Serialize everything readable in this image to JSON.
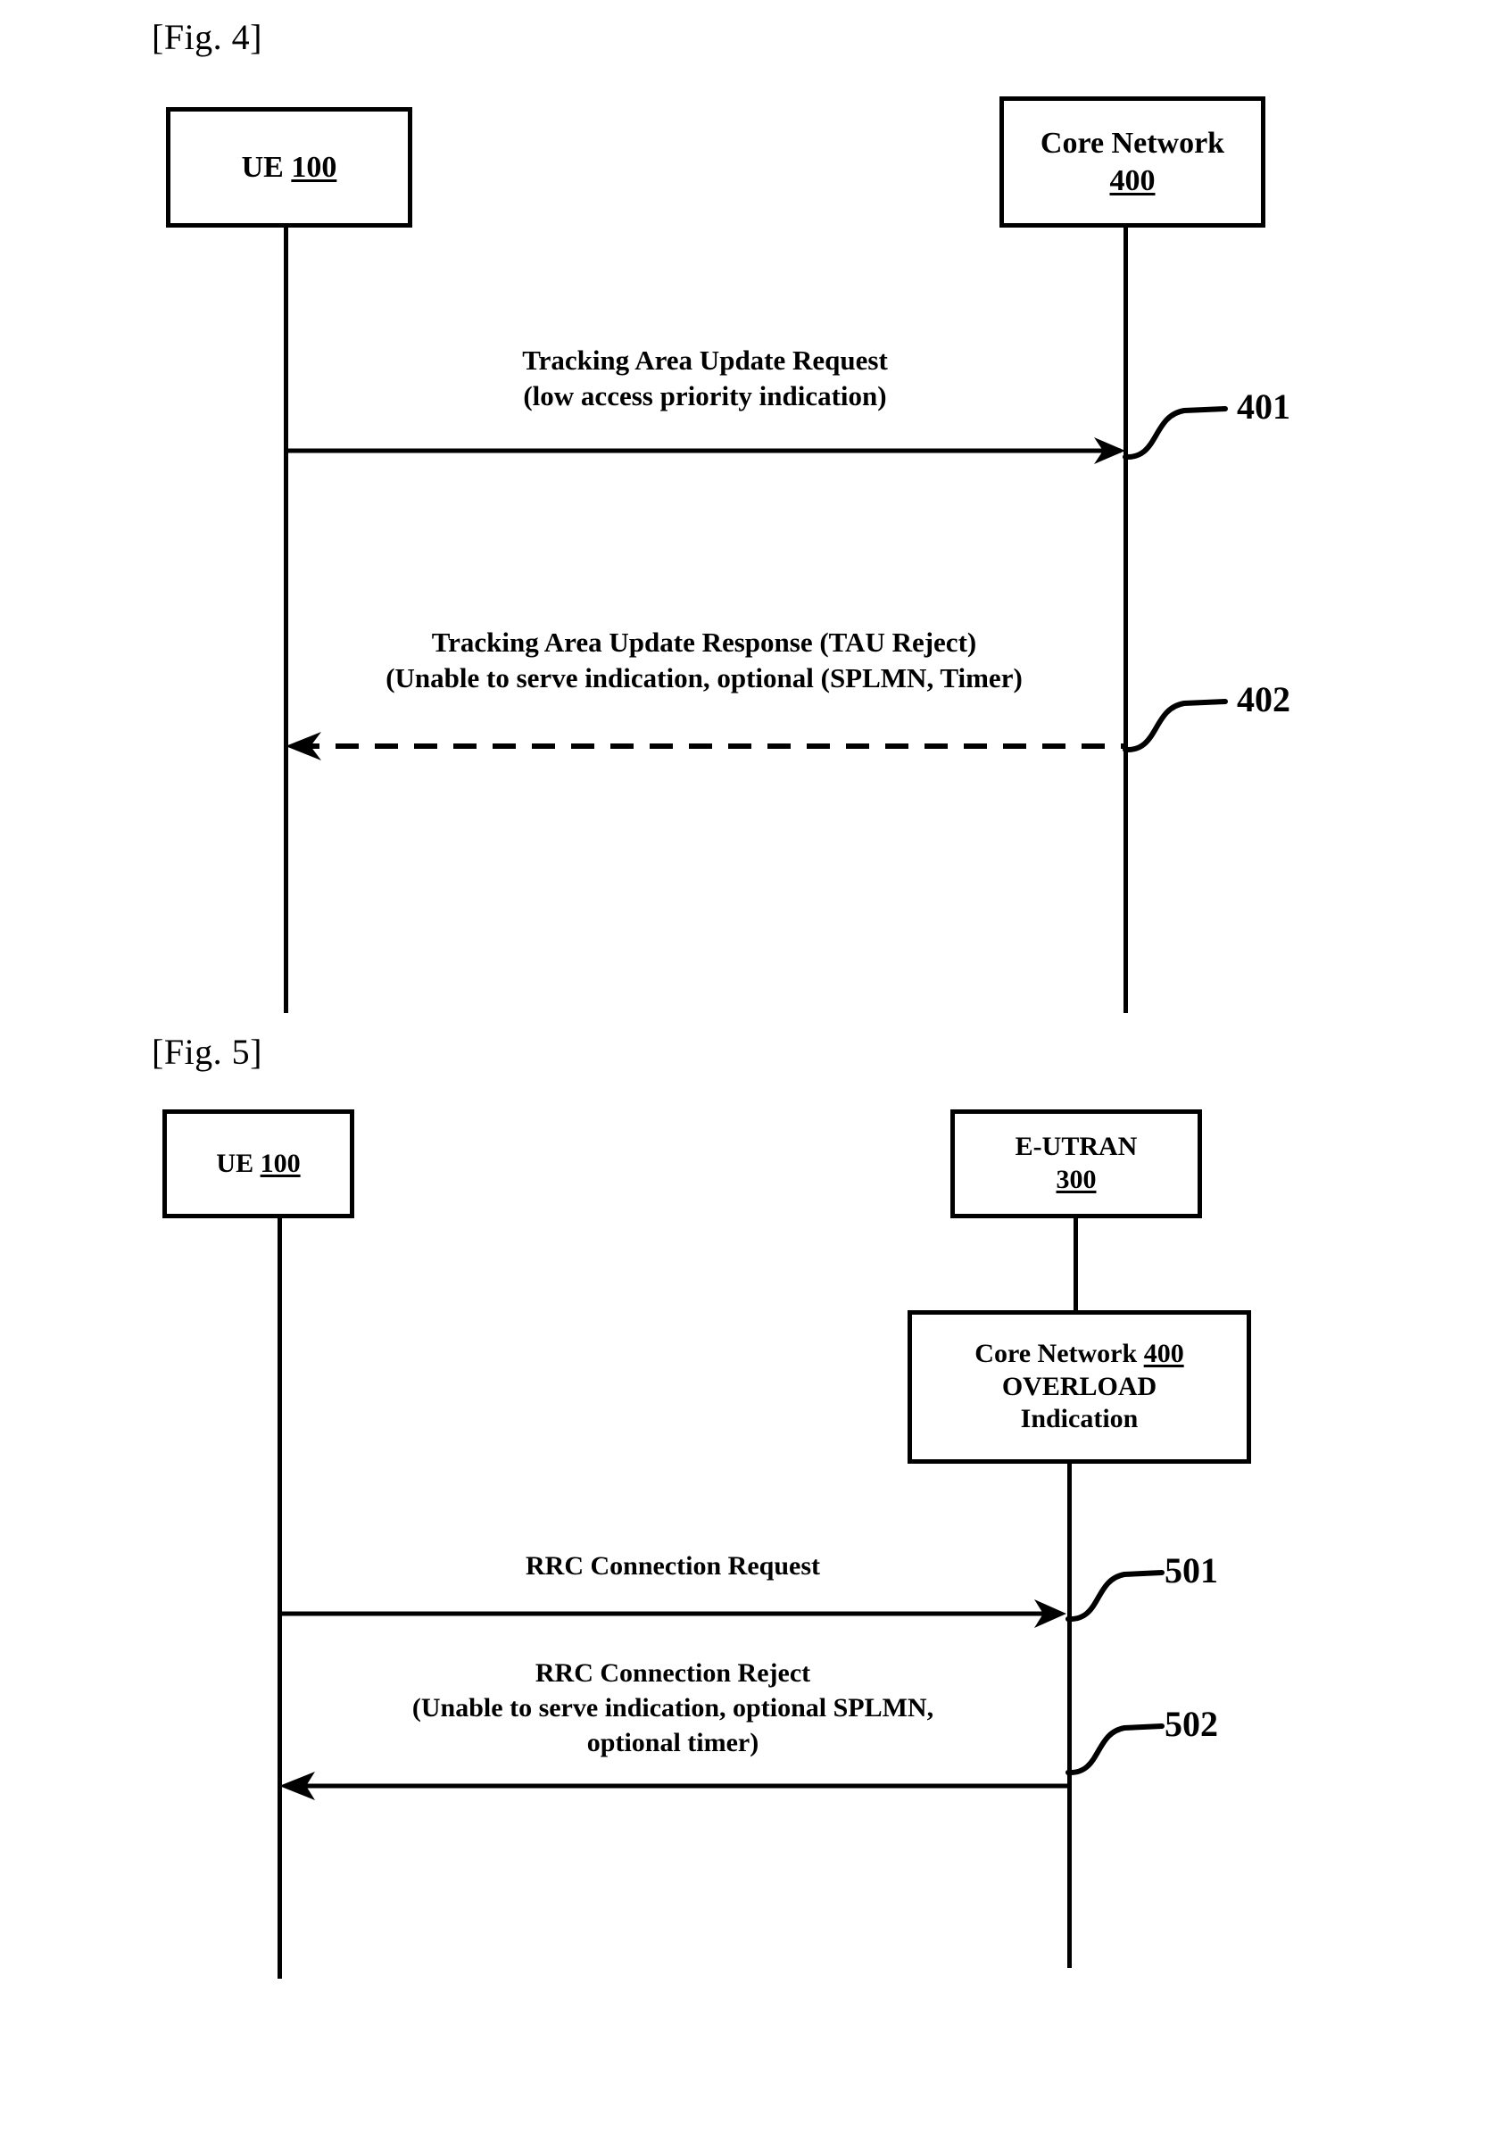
{
  "document": {
    "type": "patent-drawing-sheet",
    "figures": [
      {
        "id": "fig4",
        "caption": "[Fig. 4]",
        "nodes": [
          {
            "id": "ue",
            "name": "UE",
            "lines": [
              "UE 100"
            ],
            "label_prefix": "UE ",
            "numeral": "100"
          },
          {
            "id": "core-network",
            "name": "Core Network",
            "lines": [
              "Core Network",
              "400"
            ],
            "label_prefix": "Core Network",
            "numeral": "400"
          }
        ],
        "messages": [
          {
            "id": "401",
            "numeral": "401",
            "direction": "right",
            "style": "solid",
            "from": "UE",
            "to": "Core Network",
            "lines": [
              "Tracking Area Update Request",
              "(low access priority indication)"
            ]
          },
          {
            "id": "402",
            "numeral": "402",
            "direction": "left",
            "style": "dashed",
            "from": "Core Network",
            "to": "UE",
            "lines": [
              "Tracking Area Update Response (TAU Reject)",
              "(Unable to serve indication, optional (SPLMN, Timer)"
            ]
          }
        ]
      },
      {
        "id": "fig5",
        "caption": "[Fig. 5]",
        "nodes": [
          {
            "id": "ue",
            "name": "UE",
            "lines": [
              "UE 100"
            ],
            "label_prefix": "UE ",
            "numeral": "100"
          },
          {
            "id": "eutran",
            "name": "E-UTRAN",
            "lines": [
              "E-UTRAN",
              "300"
            ],
            "label_prefix": "E-UTRAN",
            "numeral": "300"
          },
          {
            "id": "overload",
            "name": "Core Network Overload Indication",
            "lines": [
              "Core Network 400",
              "OVERLOAD",
              "Indication"
            ],
            "label_prefix": "Core Network ",
            "numeral": "400",
            "line2": "OVERLOAD",
            "line3": "Indication"
          }
        ],
        "messages": [
          {
            "id": "501",
            "numeral": "501",
            "direction": "right",
            "style": "solid",
            "from": "UE",
            "to": "E-UTRAN",
            "lines": [
              "RRC Connection Request"
            ]
          },
          {
            "id": "502",
            "numeral": "502",
            "direction": "left",
            "style": "solid",
            "from": "E-UTRAN",
            "to": "UE",
            "lines": [
              "RRC Connection Reject",
              "(Unable to serve indication, optional SPLMN,",
              "optional timer)"
            ]
          }
        ]
      }
    ]
  },
  "colors": {
    "ink": "#000000",
    "paper": "#ffffff"
  }
}
